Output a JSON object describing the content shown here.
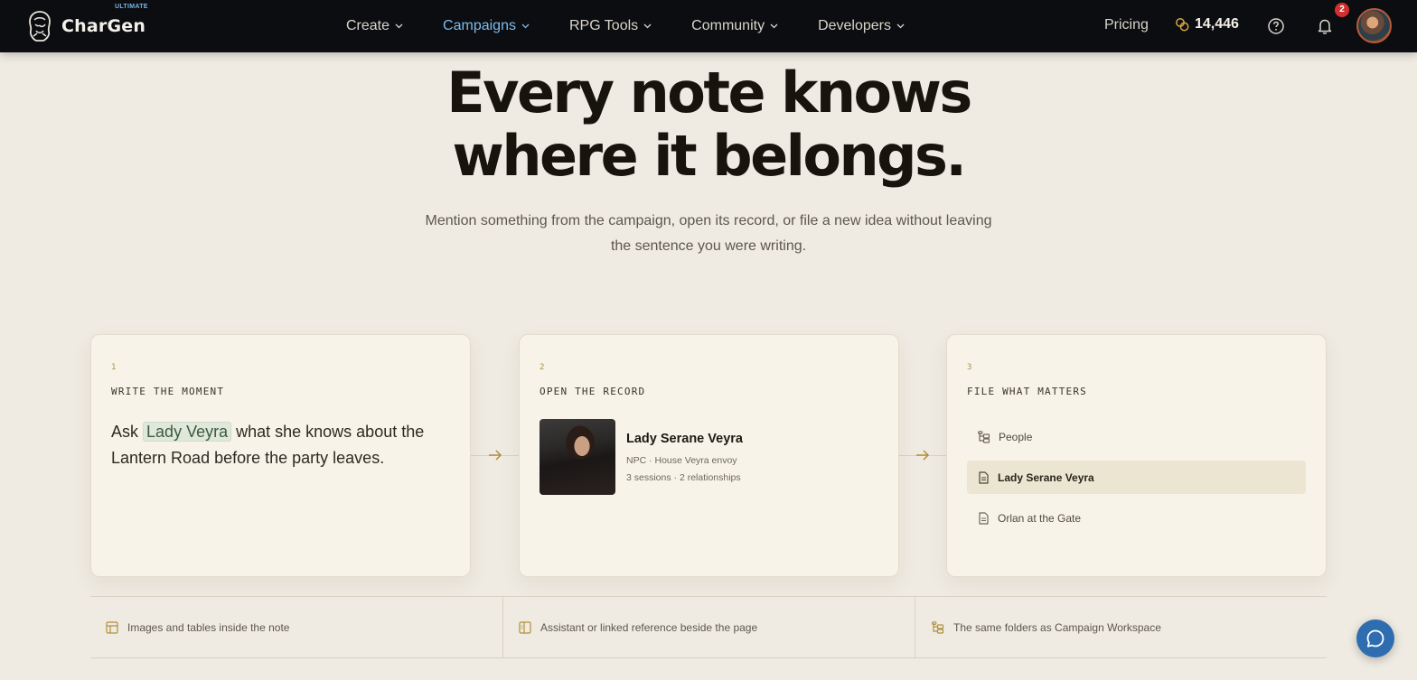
{
  "nav": {
    "brand": "CharGen",
    "brand_badge": "ULTIMATE",
    "menu": [
      {
        "label": "Create",
        "active": false
      },
      {
        "label": "Campaigns",
        "active": true
      },
      {
        "label": "RPG Tools",
        "active": false
      },
      {
        "label": "Community",
        "active": false
      },
      {
        "label": "Developers",
        "active": false
      }
    ],
    "pricing": "Pricing",
    "coins": "14,446",
    "notifications": "2"
  },
  "hero": {
    "title_line1": "Every note knows",
    "title_line2": "where it belongs.",
    "subtitle_line1": "Mention something from the campaign, open its record, or file a new idea without leaving",
    "subtitle_line2": "the sentence you were writing."
  },
  "cards": {
    "write": {
      "num": "1",
      "label": "WRITE THE MOMENT",
      "text_before": "Ask",
      "mention": "Lady Veyra",
      "text_after": "what she knows about the Lantern Road before the party leaves."
    },
    "open": {
      "num": "2",
      "label": "OPEN THE RECORD",
      "name": "Lady Serane Veyra",
      "meta1": "NPC · House Veyra envoy",
      "meta2": "3 sessions · 2 relationships"
    },
    "file": {
      "num": "3",
      "label": "FILE WHAT MATTERS",
      "rows": [
        {
          "label": "People",
          "icon": "folder-tree-icon",
          "selected": false
        },
        {
          "label": "Lady Serane Veyra",
          "icon": "document-icon",
          "selected": true
        },
        {
          "label": "Orlan at the Gate",
          "icon": "document-icon",
          "selected": false
        }
      ]
    }
  },
  "features": [
    {
      "label": "Images and tables inside the note",
      "icon": "table-icon"
    },
    {
      "label": "Assistant or linked reference beside the page",
      "icon": "side-panel-icon"
    },
    {
      "label": "The same folders as Campaign Workspace",
      "icon": "folder-tree-icon"
    }
  ],
  "colors": {
    "accent": "#7cbcee",
    "nav_bg": "#0c0d10",
    "page_bg": "#efebe2",
    "card_bg": "#f7f3e9",
    "chat_button": "#2e6db0",
    "badge": "#d22f2f"
  }
}
